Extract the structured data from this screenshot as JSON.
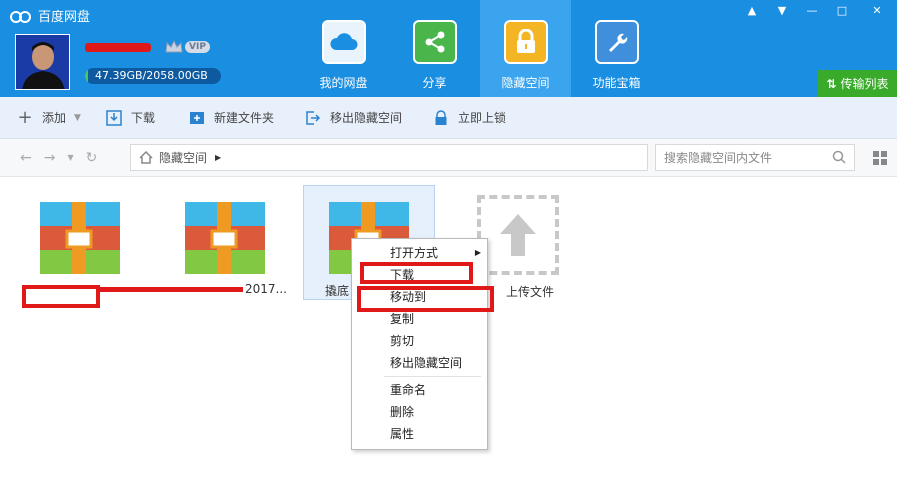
{
  "app": {
    "title": "百度网盘"
  },
  "window_controls": {
    "pin": "▲",
    "menu": "▼",
    "minimize": "—",
    "maximize": "□",
    "close": "✕"
  },
  "user": {
    "vip_label": "VIP",
    "quota_text": "47.39GB/2058.00GB",
    "quota_fraction": 0.023
  },
  "nav": [
    {
      "label": "我的网盘",
      "icon": "cloud-icon"
    },
    {
      "label": "分享",
      "icon": "share-icon"
    },
    {
      "label": "隐藏空间",
      "icon": "lock-icon"
    },
    {
      "label": "功能宝箱",
      "icon": "wrench-icon"
    }
  ],
  "transfer_label": "传输列表",
  "toolbar": {
    "add": "添加",
    "download": "下载",
    "new_folder": "新建文件夹",
    "move_out": "移出隐藏空间",
    "lock": "立即上锁"
  },
  "address": {
    "path": "隐藏空间",
    "search_placeholder": "搜索隐藏空间内文件"
  },
  "files": [
    {
      "label": ""
    },
    {
      "label": "2017..."
    },
    {
      "label": "撬底"
    },
    {
      "label": "上传文件"
    }
  ],
  "context_menu": [
    "打开方式",
    "下载",
    "移动到",
    "复制",
    "剪切",
    "移出隐藏空间",
    "重命名",
    "删除",
    "属性"
  ],
  "colors": {
    "header": "#1a8ee1",
    "active_nav": "#3aa4ee",
    "transfer": "#3aaa2a",
    "annotation": "#e01818"
  }
}
